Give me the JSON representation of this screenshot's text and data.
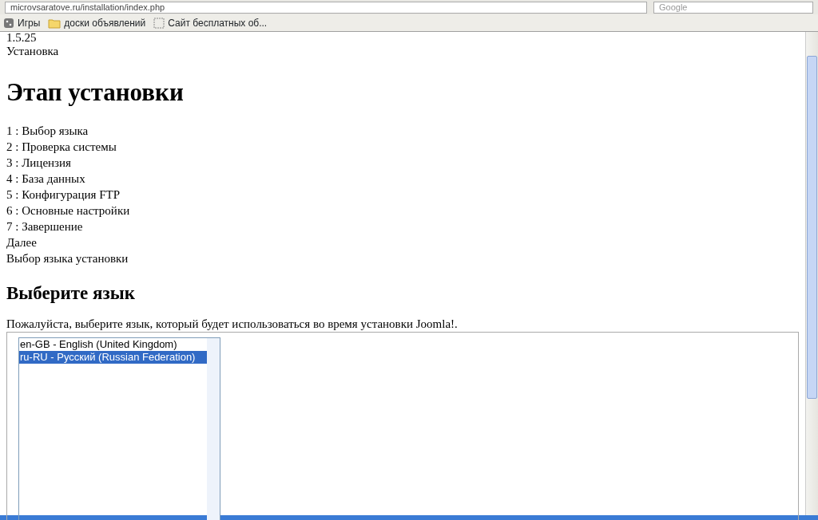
{
  "browser": {
    "url": "microvsaratove.ru/installation/index.php",
    "search_placeholder": "Google",
    "bookmarks": [
      {
        "label": "Игры",
        "kind": "app"
      },
      {
        "label": "доски объявлений",
        "kind": "folder"
      },
      {
        "label": "Сайт бесплатных об...",
        "kind": "page"
      }
    ]
  },
  "page": {
    "version": "1.5.25",
    "top_link": "Установка",
    "heading": "Этап установки",
    "steps": [
      "1 : Выбор языка",
      "2 : Проверка системы",
      "3 : Лицензия",
      "4 : База данных",
      "5 : Конфигурация FTP",
      "6 : Основные настройки",
      "7 : Завершение"
    ],
    "next": "Далее",
    "section": "Выбор языка установки",
    "subheading": "Выберите язык",
    "instructions": "Пожалуйста, выберите язык, который будет использоваться во время установки Joomla!.",
    "languages": [
      {
        "label": "en-GB - English (United Kingdom)",
        "selected": false
      },
      {
        "label": "ru-RU - Русский (Russian Federation)",
        "selected": true
      }
    ]
  }
}
